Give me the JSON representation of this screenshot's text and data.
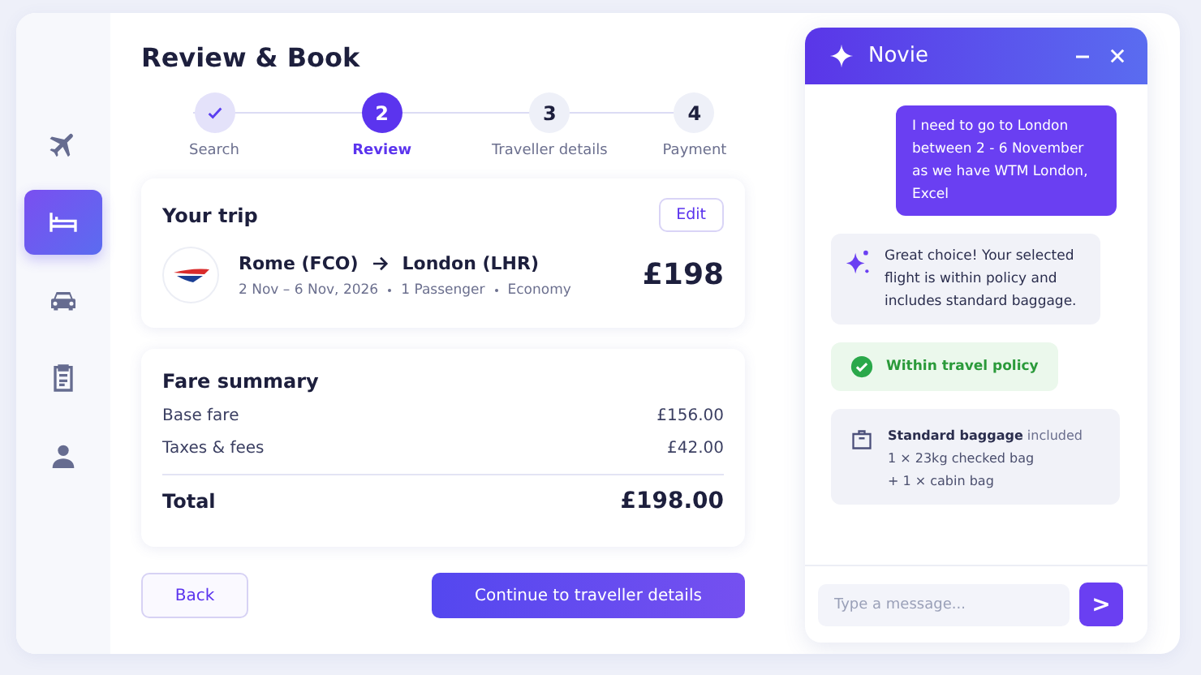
{
  "sidebar": {
    "items": [
      {
        "kind": "plane",
        "selected": false
      },
      {
        "kind": "bed",
        "selected": true
      },
      {
        "kind": "car",
        "selected": false
      },
      {
        "kind": "clipboard",
        "selected": false
      },
      {
        "kind": "person",
        "selected": false
      }
    ]
  },
  "title": "Review & Book",
  "steps": [
    {
      "label": "Search",
      "done": true,
      "selected": false
    },
    {
      "number": "2",
      "label": "Review",
      "done": false,
      "selected": true
    },
    {
      "number": "3",
      "label": "Traveller details",
      "done": false,
      "selected": false
    },
    {
      "number": "4",
      "label": "Payment",
      "done": false,
      "selected": false
    }
  ],
  "trip": {
    "title": "Your trip",
    "edit": "Edit",
    "from": "Rome (FCO)",
    "to": "London (LHR)",
    "dates": "2 Nov – 6 Nov, 2026",
    "passengers": "1 Passenger",
    "cabin": "Economy",
    "price": "£198"
  },
  "fare": {
    "title": "Fare summary",
    "rows": [
      {
        "label": "Base fare",
        "amount": "£156.00"
      },
      {
        "label": "Taxes & fees",
        "amount": "£42.00"
      }
    ],
    "total_label": "Total",
    "total": "£198.00"
  },
  "buttons": {
    "back": "Back",
    "continue": "Continue to traveller details"
  },
  "chat": {
    "title": "Novie",
    "messages": [
      {
        "kind": "user",
        "text": "I need to go to London between 2 - 6 November as we have WTM London, Excel"
      },
      {
        "kind": "bot",
        "text": "Great choice! Your selected flight is within policy and includes standard baggage."
      },
      {
        "kind": "status",
        "text": "Within travel policy"
      },
      {
        "kind": "baggage",
        "text": "**Standard baggage** included",
        "lines": [
          "1 × 23kg checked bag",
          "+ 1 × cabin bag"
        ]
      }
    ],
    "input": {
      "placeholder": "Type a message..."
    },
    "send": ">"
  }
}
